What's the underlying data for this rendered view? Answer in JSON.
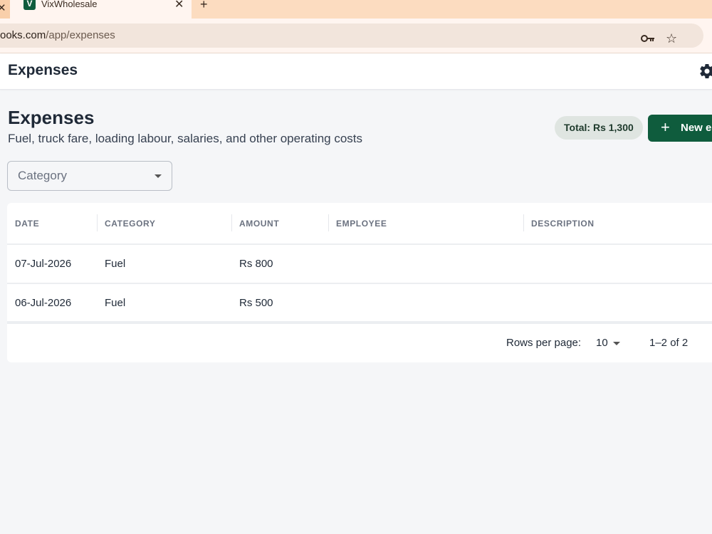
{
  "browser": {
    "active_tab_title": "VixWholesale",
    "favicon_letter": "V",
    "url_host": "ooks.com",
    "url_path": "/app/expenses",
    "icons": {
      "close": "close-icon",
      "new_tab": "plus-icon",
      "key": "key-icon",
      "star": "star-icon"
    }
  },
  "appbar": {
    "title": "Expenses",
    "settings_icon": "gear-icon"
  },
  "header": {
    "title": "Expenses",
    "subtitle": "Fuel, truck fare, loading labour, salaries, and other operating costs",
    "total_badge": "Total: Rs 1,300",
    "new_button": "New e"
  },
  "filter": {
    "category_placeholder": "Category"
  },
  "table": {
    "columns": [
      "DATE",
      "CATEGORY",
      "AMOUNT",
      "EMPLOYEE",
      "DESCRIPTION"
    ],
    "rows": [
      {
        "date": "07-Jul-2026",
        "category": "Fuel",
        "amount": "Rs 800",
        "employee": "",
        "description": ""
      },
      {
        "date": "06-Jul-2026",
        "category": "Fuel",
        "amount": "Rs 500",
        "employee": "",
        "description": ""
      }
    ],
    "footer": {
      "rows_per_page_label": "Rows per page:",
      "rows_per_page": "10",
      "range": "1–2 of 2"
    }
  },
  "colors": {
    "brand_green": "#0f5c3d",
    "tab_strip": "#fcdcc0",
    "badge_bg": "#dfe5e1"
  }
}
